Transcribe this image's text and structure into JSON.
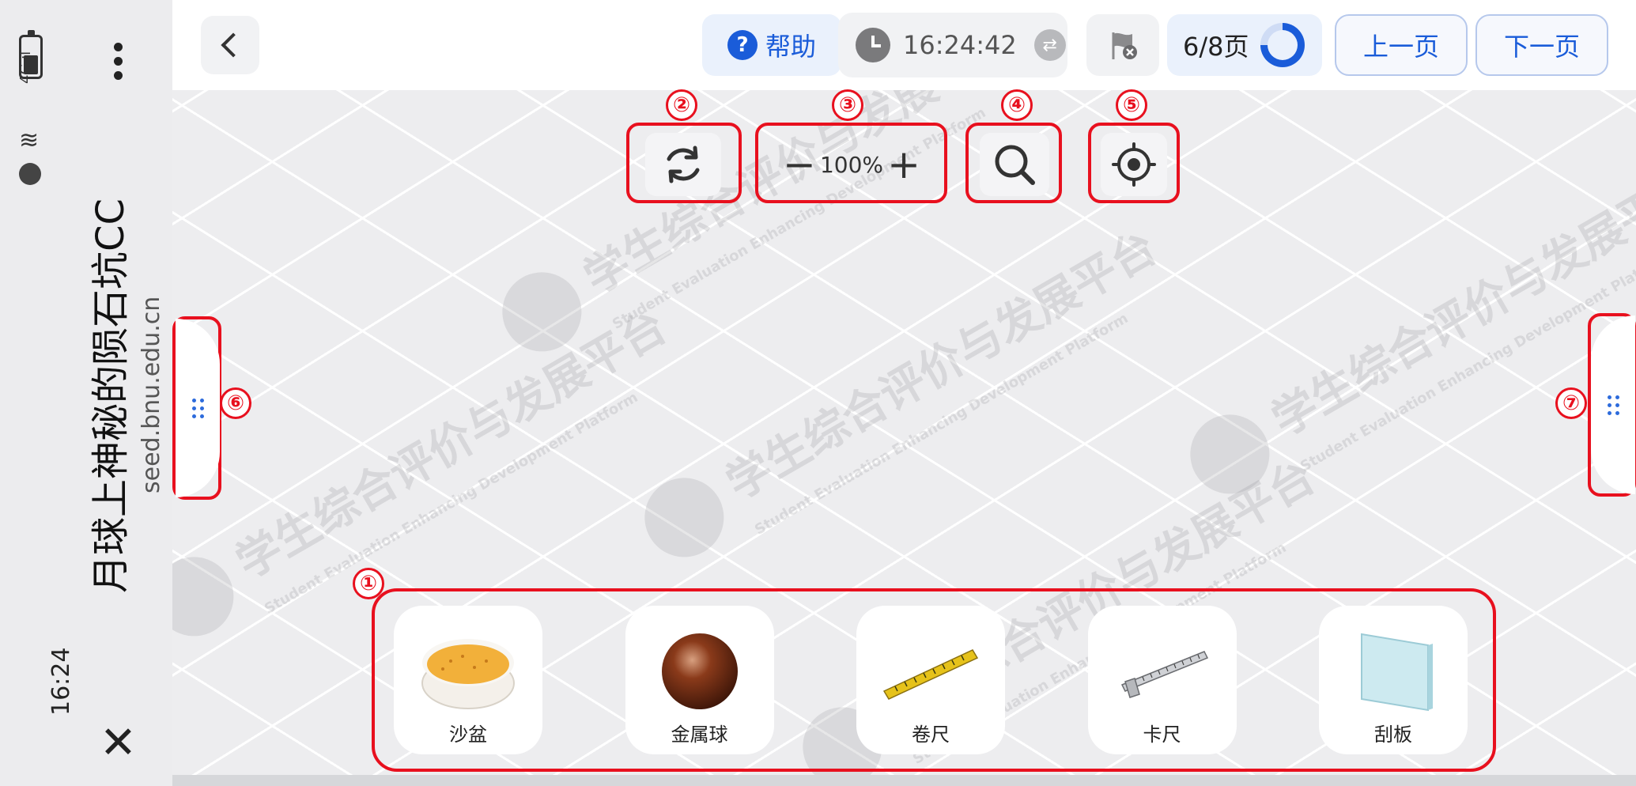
{
  "status_rail": {
    "time": "16:24",
    "network": "4G",
    "page_title": "月球上神秘的陨石坑CC",
    "url": "seed.bnu.edu.cn"
  },
  "topbar": {
    "help_label": "帮助",
    "help_icon": "?",
    "timer": "16:24:42",
    "page_indicator": "6/8页",
    "page_progress": 0.75,
    "prev_label": "上一页",
    "next_label": "下一页"
  },
  "toolbar": {
    "zoom_minus": "−",
    "zoom_level": "100%",
    "zoom_plus": "+"
  },
  "annotations": [
    "①",
    "②",
    "③",
    "④",
    "⑤",
    "⑥",
    "⑦"
  ],
  "tray": {
    "items": [
      {
        "label": "沙盆",
        "icon": "sand-basin-icon"
      },
      {
        "label": "金属球",
        "icon": "metal-ball-icon"
      },
      {
        "label": "卷尺",
        "icon": "tape-measure-icon"
      },
      {
        "label": "卡尺",
        "icon": "caliper-icon"
      },
      {
        "label": "刮板",
        "icon": "scraper-icon"
      }
    ]
  },
  "watermark": {
    "text": "学生综合评价与发展平台",
    "subtext": "Student Evaluation Enhancing Development Platform"
  },
  "colors": {
    "accent": "#1a5cd9",
    "annotation_red": "#e8101e",
    "canvas_bg": "#ededef"
  }
}
